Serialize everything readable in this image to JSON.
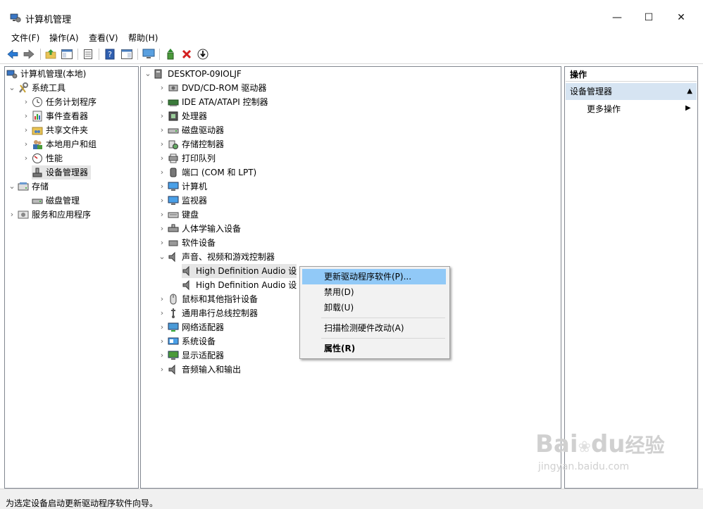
{
  "window": {
    "title": "计算机管理",
    "controls": {
      "minimize": "—",
      "maximize": "☐",
      "close": "✕"
    }
  },
  "menu": [
    "文件(F)",
    "操作(A)",
    "查看(V)",
    "帮助(H)"
  ],
  "left_tree": {
    "root": "计算机管理(本地)",
    "system_tools": "系统工具",
    "task_scheduler": "任务计划程序",
    "event_viewer": "事件查看器",
    "shared_folders": "共享文件夹",
    "local_users": "本地用户和组",
    "performance": "性能",
    "device_manager": "设备管理器",
    "storage": "存储",
    "disk_management": "磁盘管理",
    "services_apps": "服务和应用程序"
  },
  "device_tree": {
    "root": "DESKTOP-09IOLJF",
    "categories": [
      "DVD/CD-ROM 驱动器",
      "IDE ATA/ATAPI 控制器",
      "处理器",
      "磁盘驱动器",
      "存储控制器",
      "打印队列",
      "端口 (COM 和 LPT)",
      "计算机",
      "监视器",
      "键盘",
      "人体学输入设备",
      "软件设备",
      "声音、视频和游戏控制器"
    ],
    "audio_children": [
      "High Definition Audio 设",
      "High Definition Audio 设"
    ],
    "categories_after": [
      "鼠标和其他指针设备",
      "通用串行总线控制器",
      "网络适配器",
      "系统设备",
      "显示适配器",
      "音频输入和输出"
    ]
  },
  "context_menu": {
    "update_driver": "更新驱动程序软件(P)...",
    "disable": "禁用(D)",
    "uninstall": "卸载(U)",
    "scan": "扫描检测硬件改动(A)",
    "properties": "属性(R)"
  },
  "actions": {
    "header": "操作",
    "section": "设备管理器",
    "more": "更多操作"
  },
  "status": "为选定设备启动更新驱动程序软件向导。",
  "watermark": {
    "brand": "Bai",
    "brand2": "du",
    "brand3": "经验",
    "url": "jingyan.baidu.com"
  },
  "colors": {
    "highlight": "#91c9f7",
    "action_section": "#d6e4f2",
    "selection": "#e5e5e5"
  }
}
